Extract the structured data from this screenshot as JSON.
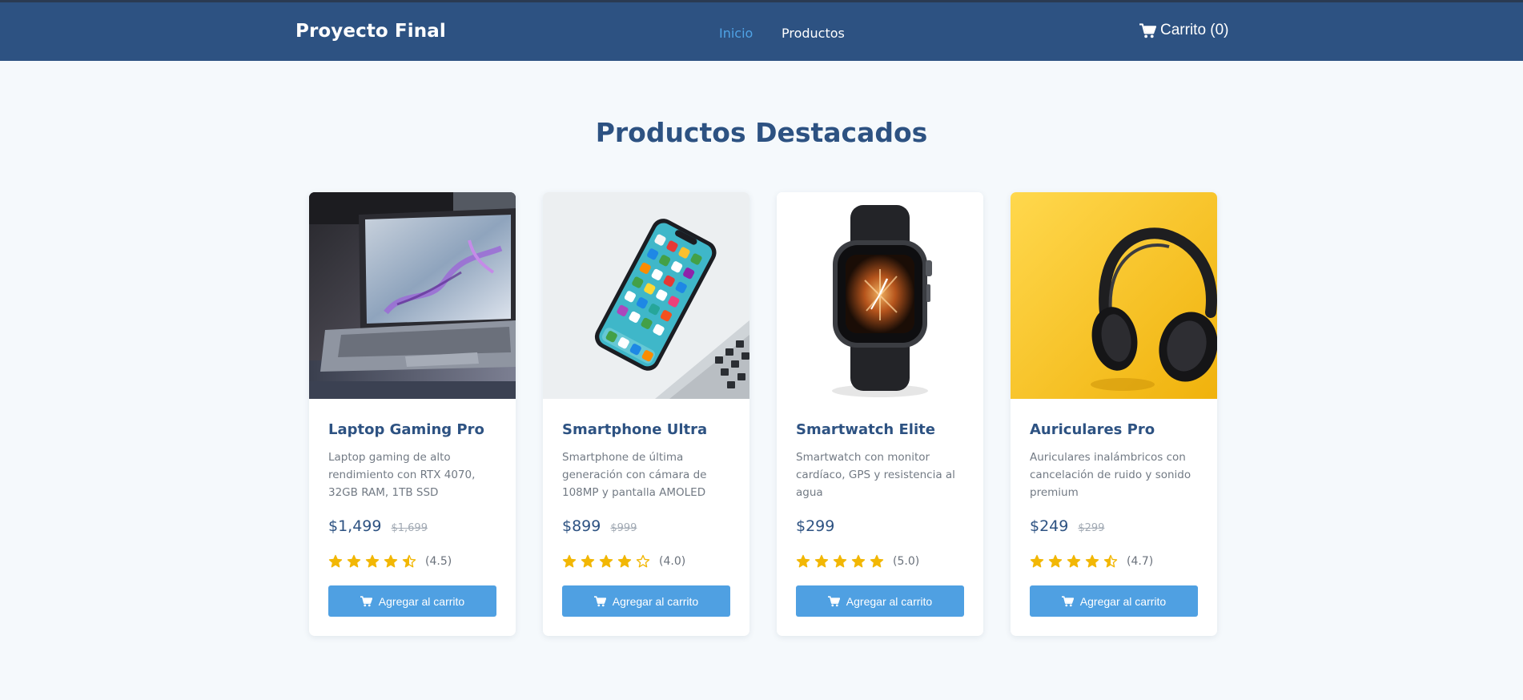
{
  "navbar": {
    "brand": "Proyecto Final",
    "links": [
      {
        "label": "Inicio",
        "active": true
      },
      {
        "label": "Productos",
        "active": false
      }
    ],
    "cart": {
      "label": "Carrito (0)",
      "icon": "shopping-cart-icon"
    }
  },
  "main": {
    "title": "Productos Destacados",
    "products": [
      {
        "name": "Laptop Gaming Pro",
        "description": "Laptop gaming de alto rendimiento con RTX 4070, 32GB RAM, 1TB SSD",
        "price": "$1,499",
        "old_price": "$1,699",
        "rating": 4.5,
        "rating_text": "(4.5)",
        "button_label": "Agregar al carrito",
        "image": "laptop-photo"
      },
      {
        "name": "Smartphone Ultra",
        "description": "Smartphone de última generación con cámara de 108MP y pantalla AMOLED",
        "price": "$899",
        "old_price": "$999",
        "rating": 4.0,
        "rating_text": "(4.0)",
        "button_label": "Agregar al carrito",
        "image": "smartphone-photo"
      },
      {
        "name": "Smartwatch Elite",
        "description": "Smartwatch con monitor cardíaco, GPS y resistencia al agua",
        "price": "$299",
        "old_price": "",
        "rating": 5.0,
        "rating_text": "(5.0)",
        "button_label": "Agregar al carrito",
        "image": "smartwatch-photo"
      },
      {
        "name": "Auriculares Pro",
        "description": "Auriculares inalámbricos con cancelación de ruido y sonido premium",
        "price": "$249",
        "old_price": "$299",
        "rating": 4.7,
        "rating_text": "(4.7)",
        "button_label": "Agregar al carrito",
        "image": "headphones-photo"
      }
    ]
  },
  "colors": {
    "navbar": "#2d5282",
    "accent": "#4fa0e2",
    "star": "#f2b705",
    "background": "#f5f9fc"
  }
}
